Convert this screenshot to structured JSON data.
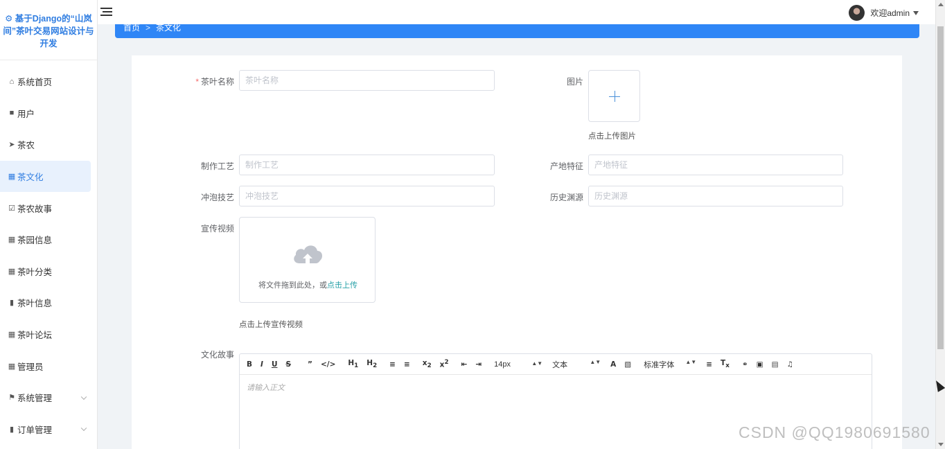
{
  "app": {
    "title": "基于Django的“山岚间”茶叶交易网站设计与开发"
  },
  "sidebar": {
    "items": [
      {
        "label": "系统首页",
        "icon": "home-icon"
      },
      {
        "label": "用户",
        "icon": "briefcase-icon"
      },
      {
        "label": "茶农",
        "icon": "send-icon"
      },
      {
        "label": "茶文化",
        "icon": "grid-icon",
        "active": true
      },
      {
        "label": "茶农故事",
        "icon": "checkbox-icon"
      },
      {
        "label": "茶园信息",
        "icon": "grid-icon"
      },
      {
        "label": "茶叶分类",
        "icon": "grid-icon"
      },
      {
        "label": "茶叶信息",
        "icon": "chat-icon"
      },
      {
        "label": "茶叶论坛",
        "icon": "grid-icon"
      },
      {
        "label": "管理员",
        "icon": "grid-icon"
      },
      {
        "label": "系统管理",
        "icon": "flag-icon",
        "expandable": true
      },
      {
        "label": "订单管理",
        "icon": "chat-icon",
        "expandable": true
      }
    ]
  },
  "header": {
    "welcome": "欢迎admin"
  },
  "breadcrumb": {
    "home": "首页",
    "sep": ">",
    "current": "茶文化"
  },
  "form": {
    "name_label": "茶叶名称",
    "name_placeholder": "茶叶名称",
    "image_label": "图片",
    "image_hint": "点击上传图片",
    "craft_label": "制作工艺",
    "craft_placeholder": "制作工艺",
    "origin_label": "产地特征",
    "origin_placeholder": "产地特征",
    "brew_label": "冲泡技艺",
    "brew_placeholder": "冲泡技艺",
    "history_label": "历史渊源",
    "history_placeholder": "历史渊源",
    "video_label": "宣传视频",
    "video_drop_text": "将文件拖到此处，或",
    "video_drop_link": "点击上传",
    "video_hint": "点击上传宣传视频",
    "story_label": "文化故事"
  },
  "editor": {
    "font_size": "14px",
    "block_type": "文本",
    "font_family": "标准字体",
    "placeholder": "请输入正文"
  },
  "watermark": "CSDN @QQ1980691580",
  "colors": {
    "accent": "#2f86f6",
    "link": "#28a1a8",
    "required": "#f56c6c"
  }
}
